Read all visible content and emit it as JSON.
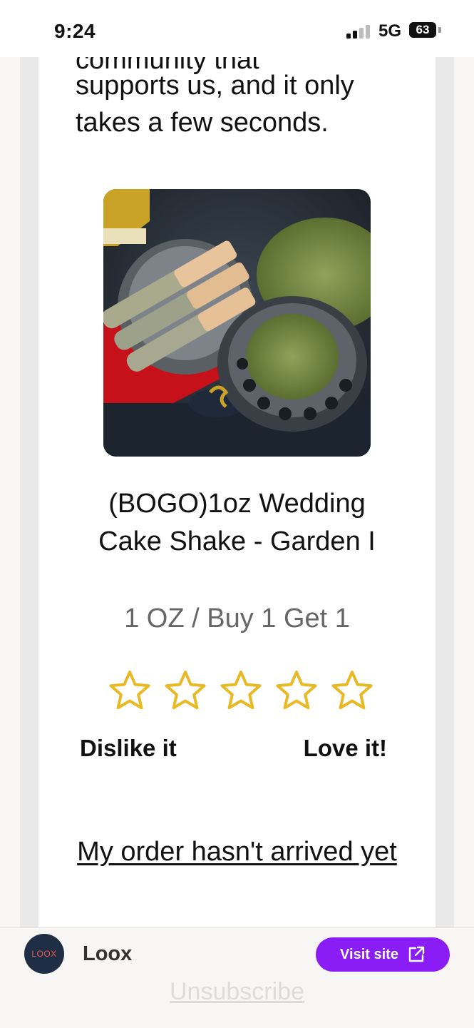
{
  "status_bar": {
    "time": "9:24",
    "network": "5G",
    "battery": "63"
  },
  "email": {
    "intro_cut_line": "community that",
    "intro_text": "supports us, and it only takes a few seconds.",
    "product": {
      "image_icon": "product-photo-prerolls-grinder",
      "title": "(BOGO)1oz Wedding Cake Shake - Garden I",
      "variant": "1 OZ / Buy 1 Get 1"
    },
    "rating": {
      "star_count": 5,
      "star_color": "#e8b923",
      "low_label": "Dislike it",
      "high_label": "Love it!"
    },
    "order_link": "My order hasn't arrived yet"
  },
  "sender_bar": {
    "logo_text": "LOOX",
    "name": "Loox",
    "visit_button": "Visit site",
    "visit_icon": "external-link-icon",
    "button_color": "#8a1cf5",
    "unsubscribe": "Unsubscribe"
  }
}
